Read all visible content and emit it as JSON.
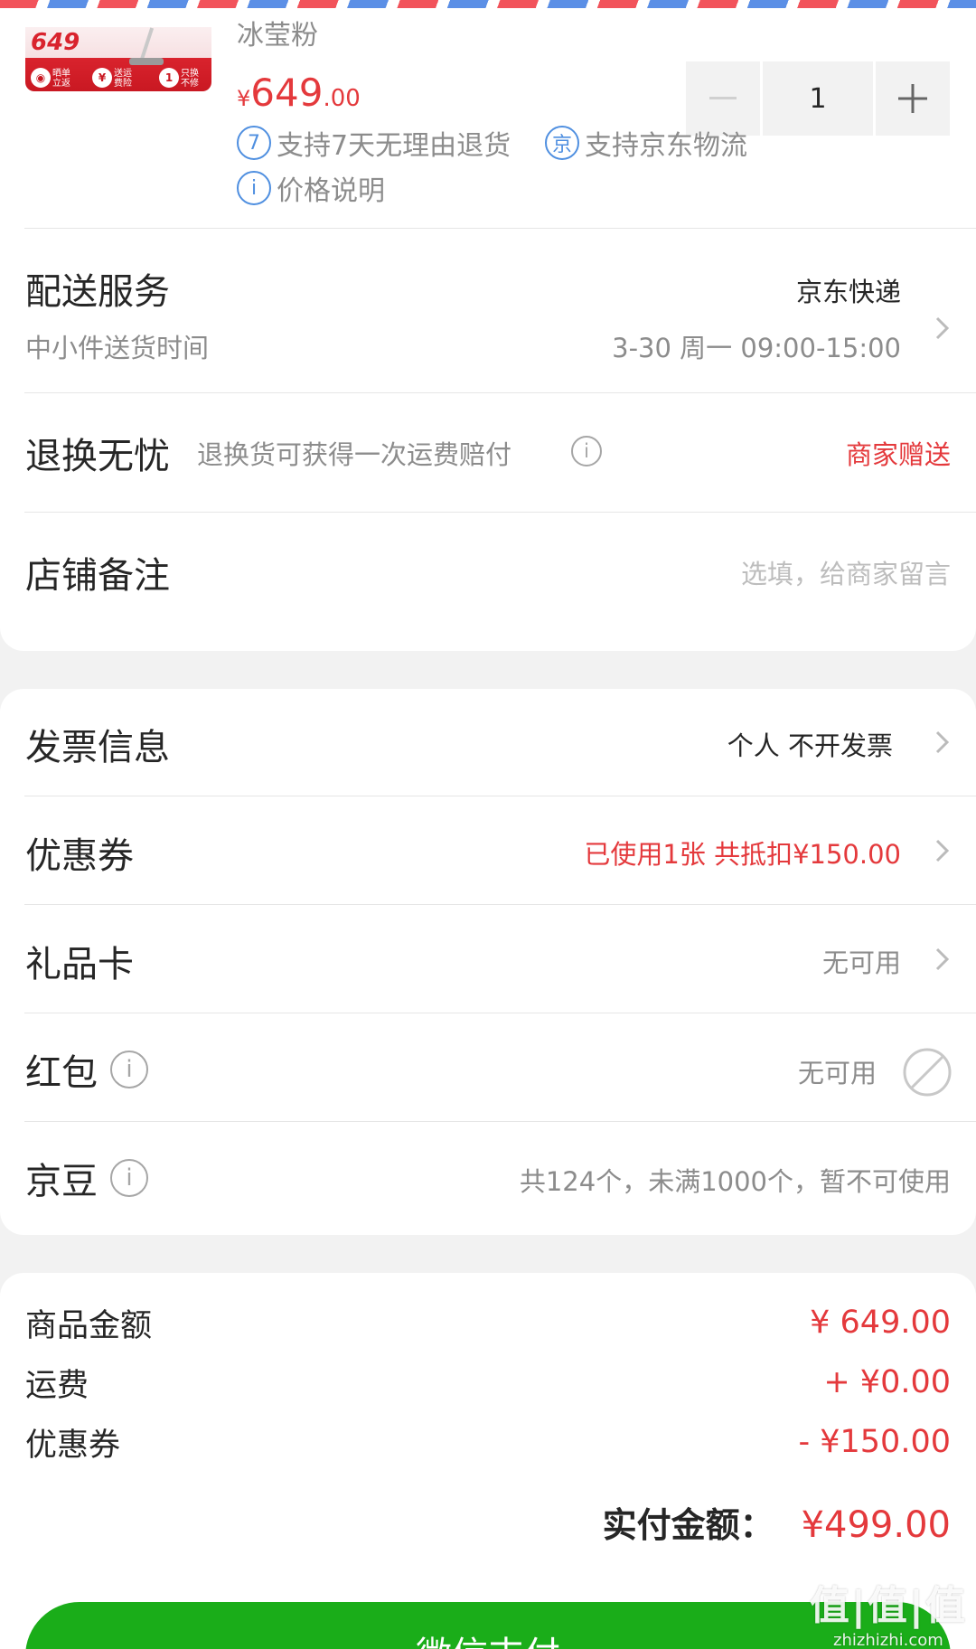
{
  "product": {
    "thumb_price": "649",
    "thumb_badges": [
      "晒单 30元 立返",
      "送运 费险",
      "1年 只换 不修"
    ],
    "variant": "冰莹粉",
    "price_symbol": "¥",
    "price_int": "649",
    "price_dec": ".00",
    "quantity": "1",
    "services": [
      {
        "icon_text": "7",
        "label": "支持7天无理由退货"
      },
      {
        "icon_text": "京",
        "label": "支持京东物流"
      },
      {
        "icon_text": "i",
        "label": "价格说明"
      }
    ]
  },
  "delivery": {
    "title": "配送服务",
    "subtitle": "中小件送货时间",
    "carrier": "京东快递",
    "time": "3-30 周一 09:00-15:00"
  },
  "return_worry_free": {
    "title": "退换无忧",
    "desc": "退换货可获得一次运费赔付",
    "value": "商家赠送"
  },
  "store_note": {
    "title": "店铺备注",
    "placeholder": "选填，给商家留言"
  },
  "invoice": {
    "title": "发票信息",
    "value": "个人 不开发票"
  },
  "coupon": {
    "title": "优惠券",
    "value": "已使用1张 共抵扣¥150.00"
  },
  "gift_card": {
    "title": "礼品卡",
    "value": "无可用"
  },
  "red_packet": {
    "title": "红包",
    "value": "无可用"
  },
  "jingdou": {
    "title": "京豆",
    "value": "共124个，未满1000个，暂不可使用"
  },
  "summary": [
    {
      "label": "商品金额",
      "value": "¥ 649.00"
    },
    {
      "label": "运费",
      "value": "+ ¥0.00"
    },
    {
      "label": "优惠券",
      "value": "- ¥150.00"
    }
  ],
  "total": {
    "label": "实付金额：",
    "value": "¥499.00"
  },
  "pay_button": "微信支付",
  "watermark": {
    "logo": "值|值|值",
    "site": "zhizhizhi.com"
  },
  "colors": {
    "accent_red": "#e4393c",
    "wechat_green": "#1aad19",
    "link_blue": "#4f8fe0"
  }
}
